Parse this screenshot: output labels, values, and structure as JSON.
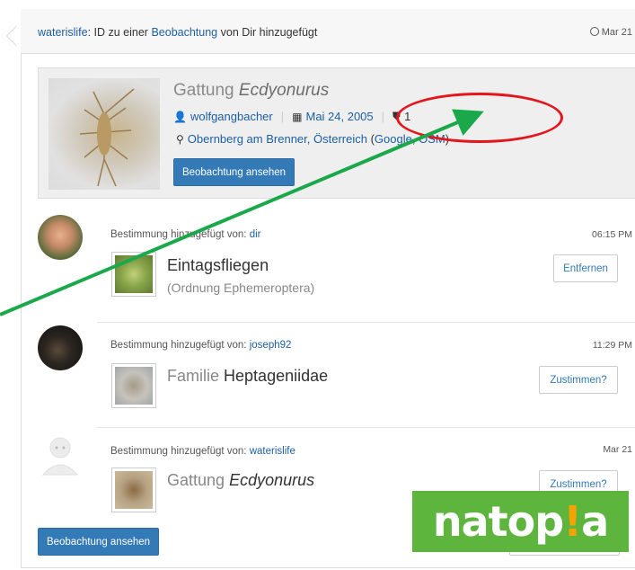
{
  "header": {
    "user": "waterislife",
    "text_before_link": ": ID zu einer ",
    "link": "Beobachtung",
    "text_after_link": " von Dir hinzugefügt",
    "date": "Mar 21"
  },
  "observation": {
    "rank": "Gattung",
    "taxon": "Ecdyonurus",
    "user": "wolfgangbacher",
    "date": "Mai 24, 2005",
    "id_count": "1",
    "place_name": "Obernberg am Brenner, Österreich",
    "place_extra_open": " (",
    "google": "Google",
    "slash": ", ",
    "osm": "OSM",
    "place_extra_close": ")",
    "button": "Beobachtung ansehen"
  },
  "identifications": [
    {
      "label": "Bestimmung hinzugefügt von:",
      "user": "dir",
      "time": "06:15 PM",
      "name": "Eintagsfliegen",
      "subtitle": "(Ordnung Ephemeroptera)",
      "button": "Entfernen"
    },
    {
      "label": "Bestimmung hinzugefügt von:",
      "user": "joseph92",
      "time": "11:29 PM",
      "rank": "Familie",
      "name": "Heptageniidae",
      "button": "Zustimmen?"
    },
    {
      "label": "Bestimmung hinzugefügt von:",
      "user": "waterislife",
      "time": "Mar 21",
      "rank": "Gattung",
      "name": "Ecdyonurus",
      "button": "Zustimmen?"
    }
  ],
  "footer_button": "Beobachtung ansehen",
  "logo": {
    "text_a": "natop",
    "bang": "!",
    "text_b": "a"
  },
  "colors": {
    "accent": "#337ab7",
    "annotation_arrow": "#1aa84a",
    "annotation_circle": "#e4151b",
    "logo_bg": "#5db53d"
  }
}
